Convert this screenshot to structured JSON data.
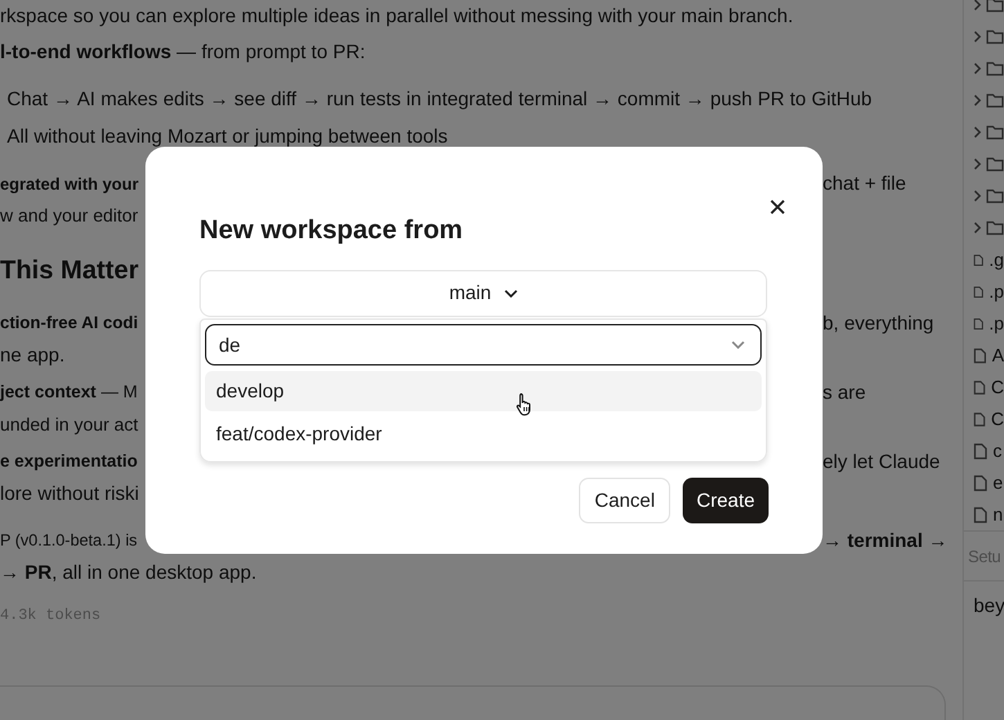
{
  "document": {
    "blocks": [
      {
        "kind": "paragraph",
        "lines": [
          {
            "text": "rkspace so you can explore multiple ideas in parallel without messing with your main branch."
          }
        ]
      },
      {
        "kind": "paragraph",
        "lines": [
          {
            "text": "**l-to-end workflows** — from prompt to PR:"
          }
        ]
      },
      {
        "kind": "paragraph",
        "lines": [
          {
            "text": "Chat → AI makes edits → see diff → run tests in integrated terminal → commit → push PR to GitHub"
          }
        ]
      },
      {
        "kind": "item",
        "lines": [
          {
            "text": "All without leaving Mozart or jumping between tools"
          }
        ]
      },
      {
        "kind": "paragraph",
        "lines": [
          {
            "left": "**egrated with your**",
            "right": "chat + file"
          },
          {
            "left": "w and your editor"
          }
        ]
      },
      {
        "kind": "heading",
        "lines": [
          {
            "left": "This Matter"
          }
        ]
      },
      {
        "kind": "paragraph",
        "lines": [
          {
            "left": "**ction-free AI codi**",
            "right": "b, everything"
          },
          {
            "left": "ne app."
          }
        ]
      },
      {
        "kind": "item",
        "lines": [
          {
            "left": "**ject context** — M",
            "right": "s are"
          },
          {
            "left": "unded in your act"
          }
        ]
      },
      {
        "kind": "item",
        "lines": [
          {
            "left": "**e experimentatio**",
            "right": "ely let Claude"
          },
          {
            "left": "lore without riski"
          }
        ]
      },
      {
        "kind": "paragraph",
        "lines": [
          {
            "left": "P (v0.1.0-beta.1) is",
            "right": "**→ terminal →**"
          },
          {
            "text": "→ **PR**, all in one desktop app."
          }
        ]
      },
      {
        "kind": "meta",
        "lines": [
          {
            "text": "4.3k tokens"
          }
        ]
      }
    ]
  },
  "sidebar": {
    "items": [
      {
        "kind": "folder"
      },
      {
        "kind": "folder"
      },
      {
        "kind": "folder"
      },
      {
        "kind": "folder"
      },
      {
        "kind": "folder"
      },
      {
        "kind": "folder"
      },
      {
        "kind": "folder"
      },
      {
        "kind": "folder"
      },
      {
        "kind": "file",
        "label": ".g"
      },
      {
        "kind": "file",
        "label": ".p"
      },
      {
        "kind": "file",
        "label": ".p"
      },
      {
        "kind": "file",
        "label": "A"
      },
      {
        "kind": "file",
        "label": "C"
      },
      {
        "kind": "file",
        "label": "C"
      },
      {
        "kind": "file",
        "label": "c"
      },
      {
        "kind": "file",
        "label": "e"
      },
      {
        "kind": "file",
        "label": "n"
      }
    ],
    "setup_placeholder": "Setu",
    "footer_text": "bey"
  },
  "dialog": {
    "title": "New workspace from",
    "branch_select": {
      "value": "main"
    },
    "search": {
      "value": "de"
    },
    "options": [
      {
        "label": "develop",
        "highlighted": true
      },
      {
        "label": "feat/codex-provider",
        "highlighted": false
      }
    ],
    "buttons": [
      {
        "label": "Cancel",
        "kind": "secondary"
      },
      {
        "label": "Create",
        "kind": "primary"
      }
    ]
  }
}
